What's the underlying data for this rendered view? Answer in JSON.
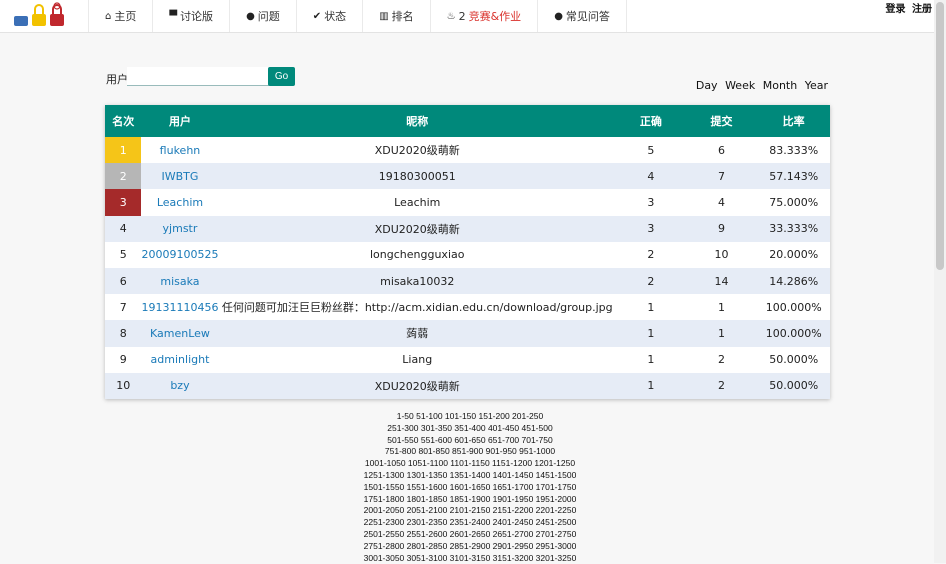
{
  "nav": {
    "items": [
      {
        "icon": "home-icon",
        "glyph": "⌂",
        "label": "主页"
      },
      {
        "icon": "comment-icon",
        "glyph": "▀",
        "label": "讨论版"
      },
      {
        "icon": "question-icon",
        "glyph": "●",
        "label": "问题"
      },
      {
        "icon": "check-icon",
        "glyph": "✔",
        "label": "状态"
      },
      {
        "icon": "bar-chart-icon",
        "glyph": "▥",
        "label": "排名"
      },
      {
        "icon": "fire-icon",
        "glyph": "♨",
        "count": "2",
        "label": "竞赛&作业"
      },
      {
        "icon": "info-icon",
        "glyph": "●",
        "label": "常见问答"
      }
    ]
  },
  "auth": {
    "login": "登录",
    "register": "注册"
  },
  "search": {
    "label": "用户",
    "value": "",
    "button": "Go"
  },
  "ranges": [
    "Day",
    "Week",
    "Month",
    "Year"
  ],
  "table": {
    "headers": [
      "名次",
      "用户",
      "昵称",
      "正确",
      "提交",
      "比率"
    ],
    "rows": [
      {
        "rank": "1",
        "user": "flukehn",
        "nick": "XDU2020级萌新",
        "solved": "5",
        "submit": "6",
        "ratio": "83.333%"
      },
      {
        "rank": "2",
        "user": "IWBTG",
        "nick": "19180300051",
        "solved": "4",
        "submit": "7",
        "ratio": "57.143%"
      },
      {
        "rank": "3",
        "user": "Leachim",
        "nick": "Leachim",
        "solved": "3",
        "submit": "4",
        "ratio": "75.000%"
      },
      {
        "rank": "4",
        "user": "yjmstr",
        "nick": "XDU2020级萌新",
        "solved": "3",
        "submit": "9",
        "ratio": "33.333%"
      },
      {
        "rank": "5",
        "user": "20009100525",
        "nick": "longchengguxiao",
        "solved": "2",
        "submit": "10",
        "ratio": "20.000%"
      },
      {
        "rank": "6",
        "user": "misaka",
        "nick": "misaka10032",
        "solved": "2",
        "submit": "14",
        "ratio": "14.286%"
      },
      {
        "rank": "7",
        "user": "19131110456",
        "nick": "任何问题可加汪巨巨粉丝群：http://acm.xidian.edu.cn/download/group.jpg",
        "solved": "1",
        "submit": "1",
        "ratio": "100.000%"
      },
      {
        "rank": "8",
        "user": "KamenLew",
        "nick": "蒟蒻",
        "solved": "1",
        "submit": "1",
        "ratio": "100.000%"
      },
      {
        "rank": "9",
        "user": "adminlight",
        "nick": "Liang",
        "solved": "1",
        "submit": "2",
        "ratio": "50.000%"
      },
      {
        "rank": "10",
        "user": "bzy",
        "nick": "XDU2020级萌新",
        "solved": "1",
        "submit": "2",
        "ratio": "50.000%"
      }
    ]
  },
  "pagination": [
    "1-50 51-100 101-150 151-200 201-250",
    "251-300 301-350 351-400 401-450 451-500",
    "501-550 551-600 601-650 651-700 701-750",
    "751-800 801-850 851-900 901-950 951-1000",
    "1001-1050 1051-1100 1101-1150 1151-1200 1201-1250",
    "1251-1300 1301-1350 1351-1400 1401-1450 1451-1500",
    "1501-1550 1551-1600 1601-1650 1651-1700 1701-1750",
    "1751-1800 1801-1850 1851-1900 1901-1950 1951-2000",
    "2001-2050 2051-2100 2101-2150 2151-2200 2201-2250",
    "2251-2300 2301-2350 2351-2400 2401-2450 2451-2500",
    "2501-2550 2551-2600 2601-2650 2651-2700 2701-2750",
    "2751-2800 2801-2850 2851-2900 2901-2950 2951-3000",
    "3001-3050 3051-3100 3101-3150 3151-3200 3201-3250"
  ]
}
